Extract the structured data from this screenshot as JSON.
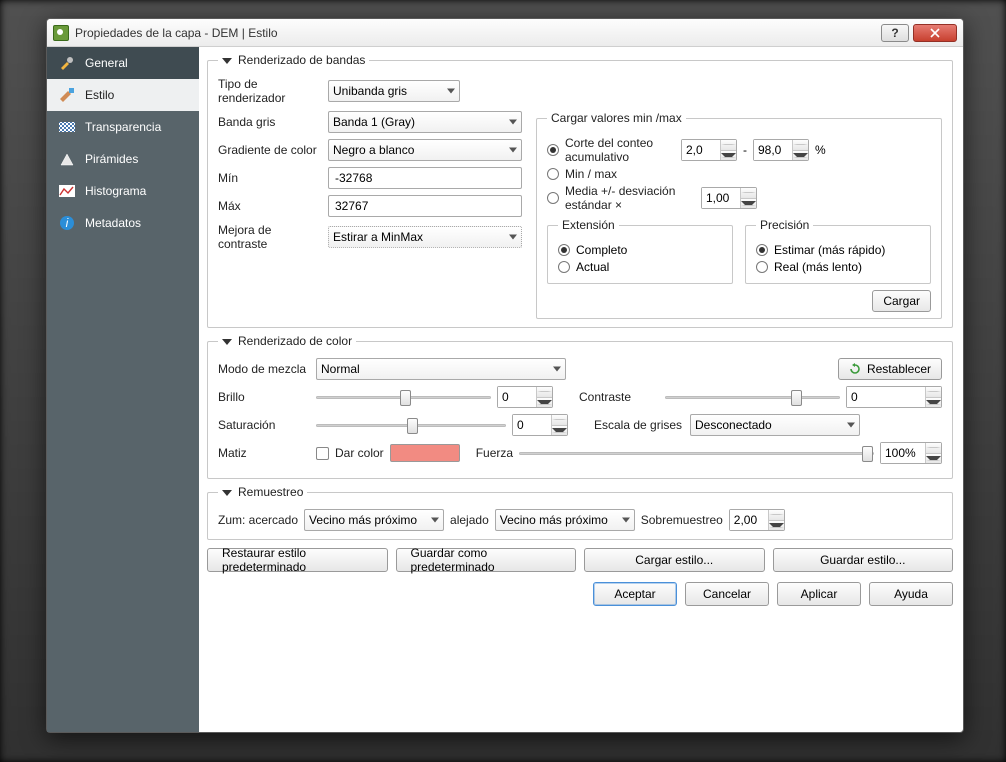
{
  "window": {
    "title": "Propiedades de la capa - DEM | Estilo"
  },
  "sidebar": {
    "items": [
      {
        "label": "General"
      },
      {
        "label": "Estilo"
      },
      {
        "label": "Transparencia"
      },
      {
        "label": "Pirámides"
      },
      {
        "label": "Histograma"
      },
      {
        "label": "Metadatos"
      }
    ]
  },
  "band": {
    "legend": "Renderizado de bandas",
    "renderer_label": "Tipo de renderizador",
    "renderer_value": "Unibanda gris",
    "gray_band_label": "Banda gris",
    "gray_band_value": "Banda 1 (Gray)",
    "gradient_label": "Gradiente de color",
    "gradient_value": "Negro a blanco",
    "min_label": "Mín",
    "min_value": "-32768",
    "max_label": "Máx",
    "max_value": "32767",
    "contrast_label": "Mejora de contraste",
    "contrast_value": "Estirar a MinMax"
  },
  "minmax": {
    "legend": "Cargar valores min /max",
    "cumulative_label": "Corte del conteo acumulativo",
    "cum_lo": "2,0",
    "cum_hi": "98,0",
    "pct": "%",
    "dash": "-",
    "minmax_label": "Min / max",
    "stddev_label": "Media +/- desviación estándar ×",
    "stddev_val": "1,00",
    "extent_legend": "Extensión",
    "extent_full": "Completo",
    "extent_current": "Actual",
    "precision_legend": "Precisión",
    "precision_est": "Estimar (más rápido)",
    "precision_real": "Real (más lento)",
    "load_btn": "Cargar"
  },
  "color": {
    "legend": "Renderizado de color",
    "blend_label": "Modo de mezcla",
    "blend_value": "Normal",
    "reset": "Restablecer",
    "brightness_label": "Brillo",
    "brightness_val": "0",
    "contrast_label": "Contraste",
    "contrast_val": "0",
    "saturation_label": "Saturación",
    "saturation_val": "0",
    "grayscale_label": "Escala de grises",
    "grayscale_value": "Desconectado",
    "hue_label": "Matiz",
    "colorize_chk": "Dar color",
    "strength_label": "Fuerza",
    "strength_val": "100%"
  },
  "resample": {
    "legend": "Remuestreo",
    "zoom_in_label": "Zum: acercado",
    "zoom_in_value": "Vecino más próximo",
    "zoom_out_label": "alejado",
    "zoom_out_value": "Vecino más próximo",
    "oversample_label": "Sobremuestreo",
    "oversample_val": "2,00"
  },
  "footer": {
    "restore": "Restaurar estilo predeterminado",
    "save_default": "Guardar como predeterminado",
    "load_style": "Cargar estilo...",
    "save_style": "Guardar estilo...",
    "ok": "Aceptar",
    "cancel": "Cancelar",
    "apply": "Aplicar",
    "help": "Ayuda"
  }
}
